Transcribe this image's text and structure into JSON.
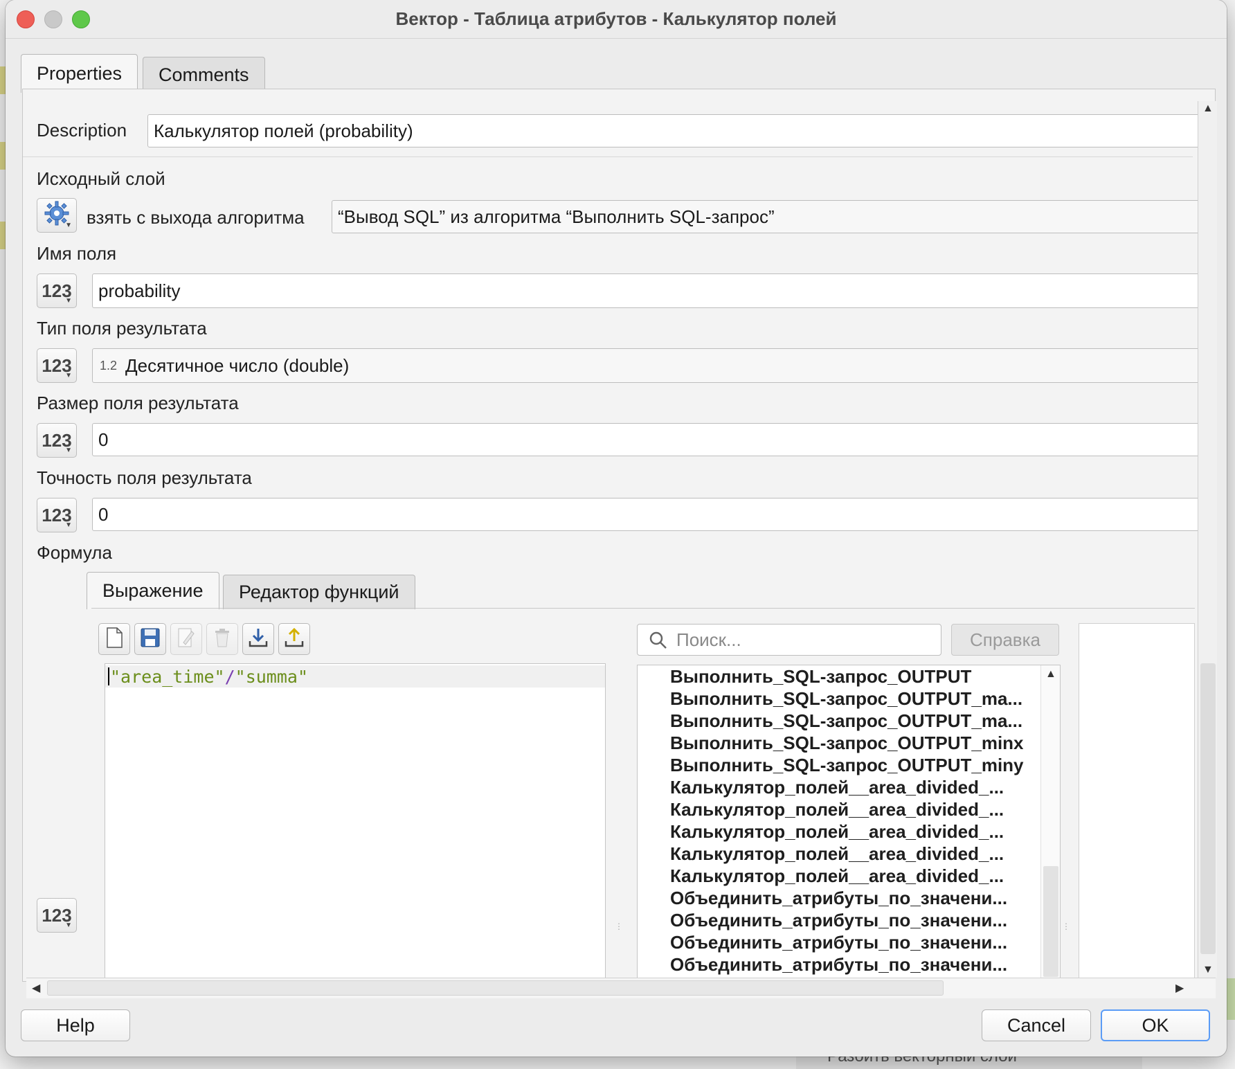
{
  "window": {
    "title": "Вектор - Таблица атрибутов - Калькулятор полей"
  },
  "tabs": [
    "Properties",
    "Comments"
  ],
  "description": {
    "label": "Description",
    "value": "Калькулятор полей (probability)"
  },
  "source_layer": {
    "label": "Исходный слой",
    "mode_label": "взять с выхода алгоритма",
    "value": "“Вывод SQL” из алгоритма “Выполнить SQL-запрос”",
    "icon": "gear-icon"
  },
  "field_name": {
    "label": "Имя поля",
    "value": "probability",
    "button": "123"
  },
  "field_type": {
    "label": "Тип поля результата",
    "type_badge": "1.2",
    "value": "Десятичное число (double)",
    "button": "123"
  },
  "field_size": {
    "label": "Размер поля результата",
    "value": "0",
    "button": "123"
  },
  "field_precision": {
    "label": "Точность поля результата",
    "value": "0",
    "button": "123"
  },
  "formula": {
    "label": "Формула",
    "tabs": [
      "Выражение",
      "Редактор функций"
    ],
    "expression_parts": [
      "\"area_time\"",
      "/",
      "\"summa\""
    ],
    "button": "123",
    "toolbar_icons": [
      "new-file-icon",
      "save-icon",
      "edit-icon",
      "delete-icon",
      "download-icon",
      "upload-icon"
    ],
    "search_placeholder": "Поиск...",
    "help_label": "Справка",
    "list_items": [
      "Выполнить_SQL-запрос_OUTPUT",
      "Выполнить_SQL-запрос_OUTPUT_ma...",
      "Выполнить_SQL-запрос_OUTPUT_ma...",
      "Выполнить_SQL-запрос_OUTPUT_minx",
      "Выполнить_SQL-запрос_OUTPUT_miny",
      "Калькулятор_полей__area_divided_...",
      "Калькулятор_полей__area_divided_...",
      "Калькулятор_полей__area_divided_...",
      "Калькулятор_полей__area_divided_...",
      "Калькулятор_полей__area_divided_...",
      "Объединить_атрибуты_по_значени...",
      "Объединить_атрибуты_по_значени...",
      "Объединить_атрибуты_по_значени...",
      "Объединить_атрибуты_по_значени..."
    ]
  },
  "buttons": {
    "help": "Help",
    "cancel": "Cancel",
    "ok": "OK"
  },
  "background": {
    "bottom_text": "Разбить векторный слой"
  },
  "colors": {
    "expression_string": "#6b8e1b",
    "operator": "#7a3fb0",
    "default_button_border": "#5b9cf6"
  }
}
